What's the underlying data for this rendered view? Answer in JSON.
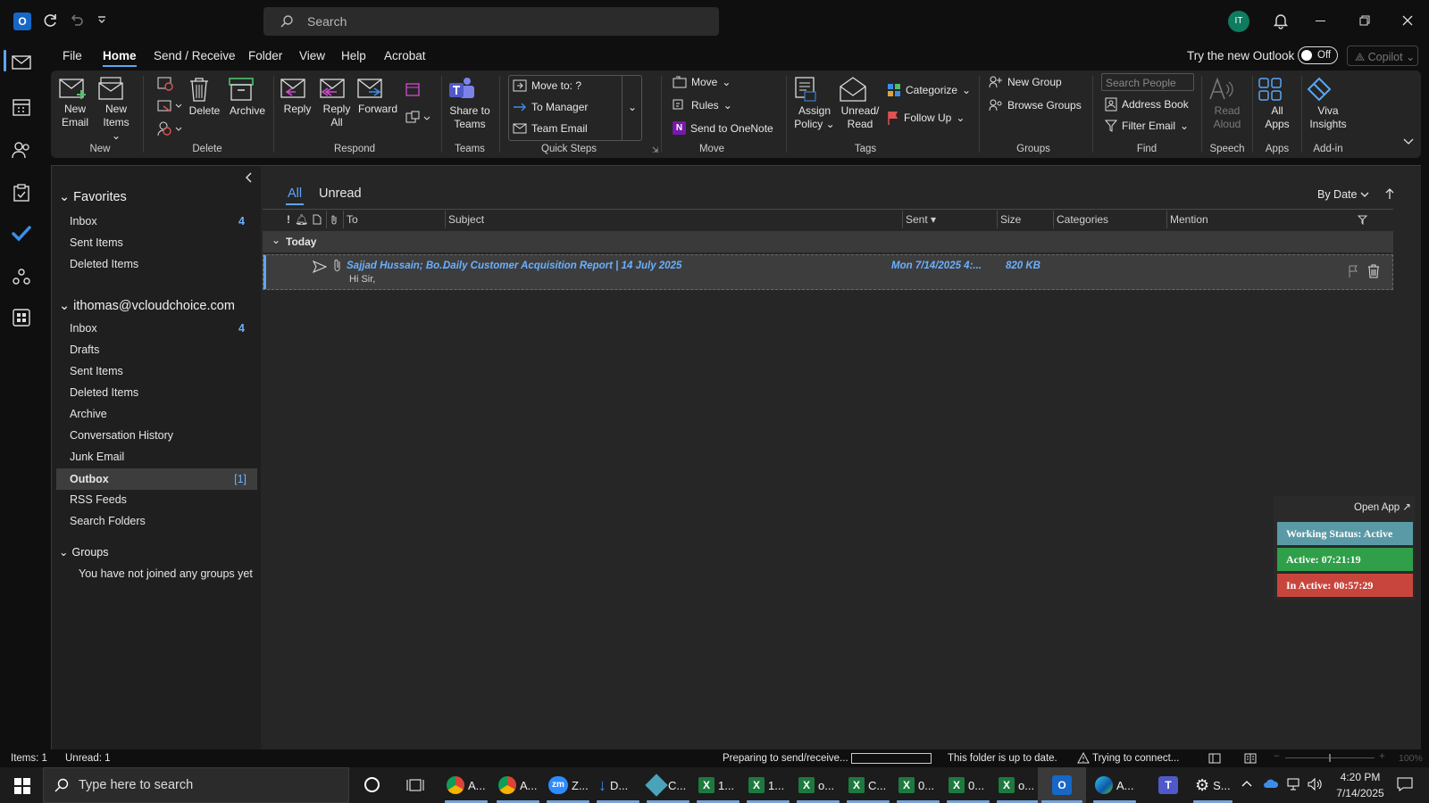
{
  "titlebar": {
    "search_placeholder": "Search",
    "avatar_initials": "IT"
  },
  "menu": {
    "tabs": [
      "File",
      "Home",
      "Send / Receive",
      "Folder",
      "View",
      "Help",
      "Acrobat"
    ],
    "active": "Home",
    "try_new_outlook": "Try the new Outlook",
    "toggle_state": "Off",
    "copilot": "Copilot"
  },
  "ribbon": {
    "new_email": [
      "New",
      "Email"
    ],
    "new_items": [
      "New",
      "Items"
    ],
    "delete": "Delete",
    "archive": "Archive",
    "reply": "Reply",
    "reply_all": [
      "Reply",
      "All"
    ],
    "forward": "Forward",
    "share_teams": [
      "Share to",
      "Teams"
    ],
    "quick_steps": [
      "Move to: ?",
      "To Manager",
      "Team Email"
    ],
    "move": "Move",
    "rules": "Rules",
    "send_onenote": "Send to OneNote",
    "assign_policy": [
      "Assign",
      "Policy"
    ],
    "unread_read": [
      "Unread/",
      "Read"
    ],
    "categorize": "Categorize",
    "follow_up": "Follow Up",
    "new_group": "New Group",
    "browse_groups": "Browse Groups",
    "search_people_placeholder": "Search People",
    "address_book": "Address Book",
    "filter_email": "Filter Email",
    "read_aloud": [
      "Read",
      "Aloud"
    ],
    "all_apps": [
      "All",
      "Apps"
    ],
    "viva_insights": [
      "Viva",
      "Insights"
    ],
    "groups": {
      "new": "New",
      "delete": "Delete",
      "respond": "Respond",
      "teams": "Teams",
      "quick_steps": "Quick Steps",
      "move": "Move",
      "tags": "Tags",
      "groups": "Groups",
      "find": "Find",
      "speech": "Speech",
      "apps": "Apps",
      "addin": "Add-in"
    }
  },
  "folders": {
    "favorites_header": "Favorites",
    "favorites": [
      {
        "label": "Inbox",
        "count": "4"
      },
      {
        "label": "Sent Items",
        "count": ""
      },
      {
        "label": "Deleted Items",
        "count": ""
      }
    ],
    "account_header": "ithomas@vcloudchoice.com",
    "account": [
      {
        "label": "Inbox",
        "count": "4"
      },
      {
        "label": "Drafts",
        "count": ""
      },
      {
        "label": "Sent Items",
        "count": ""
      },
      {
        "label": "Deleted Items",
        "count": ""
      },
      {
        "label": "Archive",
        "count": ""
      },
      {
        "label": "Conversation History",
        "count": ""
      },
      {
        "label": "Junk Email",
        "count": ""
      },
      {
        "label": "Outbox",
        "count": "[1]"
      },
      {
        "label": "RSS Feeds",
        "count": ""
      },
      {
        "label": "Search Folders",
        "count": ""
      }
    ],
    "groups_header": "Groups",
    "groups_empty": "You have not joined any groups yet"
  },
  "list": {
    "tabs": [
      "All",
      "Unread"
    ],
    "sort": "By Date",
    "columns": {
      "to": "To",
      "subject": "Subject",
      "sent": "Sent",
      "size": "Size",
      "categories": "Categories",
      "mention": "Mention"
    },
    "group_today": "Today",
    "message": {
      "to": "Sajjad Hussain; Bo...",
      "subject": "Daily Customer Acquisition Report | 14 July 2025",
      "sent": "Mon 7/14/2025 4:...",
      "size": "820 KB",
      "preview": "Hi Sir,"
    }
  },
  "widget": {
    "open_app": "Open App",
    "working_status": "Working Status: Active",
    "active": "Active: 07:21:19",
    "inactive": "In Active: 00:57:29",
    "colors": {
      "status": "#5a9aa6",
      "active": "#2f9f49",
      "inactive": "#c8453d"
    }
  },
  "status": {
    "items": "Items: 1",
    "unread": "Unread: 1",
    "preparing": "Preparing to send/receive...",
    "up_to_date": "This folder is up to date.",
    "trying": "Trying to connect...",
    "zoom": "100%"
  },
  "taskbar": {
    "search_placeholder": "Type here to search",
    "apps": [
      "A...",
      "A...",
      "Z...",
      "D...",
      "C...",
      "1...",
      "1...",
      "o...",
      "C...",
      "0...",
      "0...",
      "o...",
      "A...",
      "S..."
    ],
    "time": "4:20 PM",
    "date": "7/14/2025"
  },
  "colors": {
    "accent": "#60a5f5",
    "link_blue": "#6ab0ff",
    "bg": "#0f0f0f",
    "pane": "#262626"
  }
}
